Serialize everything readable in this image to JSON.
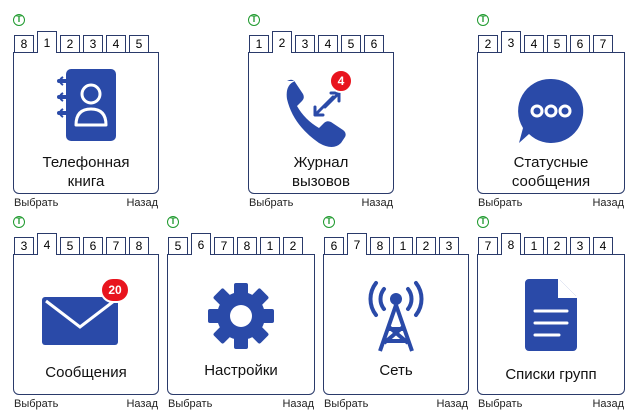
{
  "screens": [
    {
      "tabs": [
        "8",
        "1",
        "2",
        "3",
        "4",
        "5"
      ],
      "active_tab": 1,
      "label_lines": [
        "Телефонная",
        "книга"
      ],
      "icon": "phonebook-icon",
      "badge": "",
      "softkey_left": "Выбрать",
      "softkey_right": "Назад"
    },
    {
      "tabs": [
        "1",
        "2",
        "3",
        "4",
        "5",
        "6"
      ],
      "active_tab": 1,
      "label_lines": [
        "Журнал",
        "вызовов"
      ],
      "icon": "call-log-icon",
      "badge": "4",
      "softkey_left": "Выбрать",
      "softkey_right": "Назад"
    },
    {
      "tabs": [
        "2",
        "3",
        "4",
        "5",
        "6",
        "7"
      ],
      "active_tab": 1,
      "label_lines": [
        "Статусные",
        "сообщения"
      ],
      "icon": "status-messages-icon",
      "badge": "",
      "softkey_left": "Выбрать",
      "softkey_right": "Назад"
    },
    {
      "tabs": [
        "3",
        "4",
        "5",
        "6",
        "7",
        "8"
      ],
      "active_tab": 1,
      "label_lines": [
        "Сообщения"
      ],
      "icon": "envelope-icon",
      "badge": "20",
      "softkey_left": "Выбрать",
      "softkey_right": "Назад"
    },
    {
      "tabs": [
        "5",
        "6",
        "7",
        "8",
        "1",
        "2"
      ],
      "active_tab": 1,
      "label_lines": [
        "Настройки"
      ],
      "icon": "gear-icon",
      "badge": "",
      "softkey_left": "Выбрать",
      "softkey_right": "Назад"
    },
    {
      "tabs": [
        "6",
        "7",
        "8",
        "1",
        "2",
        "3"
      ],
      "active_tab": 1,
      "label_lines": [
        "Сеть"
      ],
      "icon": "antenna-icon",
      "badge": "",
      "softkey_left": "Выбрать",
      "softkey_right": "Назад"
    },
    {
      "tabs": [
        "7",
        "8",
        "1",
        "2",
        "3",
        "4"
      ],
      "active_tab": 1,
      "label_lines": [
        "Списки групп"
      ],
      "icon": "document-icon",
      "badge": "",
      "softkey_left": "Выбрать",
      "softkey_right": "Назад"
    }
  ],
  "status_indicator": "T",
  "colors": {
    "icon_blue": "#2a4aa8",
    "badge_red": "#e8141e",
    "status_green": "#1f9a2e",
    "frame": "#2a3a6a"
  }
}
